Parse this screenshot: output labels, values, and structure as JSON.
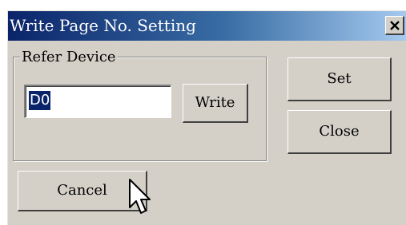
{
  "dialog": {
    "title": "Write Page No. Setting",
    "close_glyph": "×"
  },
  "refer_device": {
    "group_label": "Refer Device",
    "value": "D0",
    "write_label": "Write"
  },
  "buttons": {
    "set_label": "Set",
    "close_label": "Close",
    "cancel_label": "Cancel"
  },
  "colors": {
    "titlebar_start": "#0a246a",
    "titlebar_end": "#a6caf0",
    "dialog_face": "#d4d0c8",
    "selection": "#0a246a"
  },
  "icons": {
    "close": "close-icon",
    "cursor": "mouse-pointer-icon"
  }
}
